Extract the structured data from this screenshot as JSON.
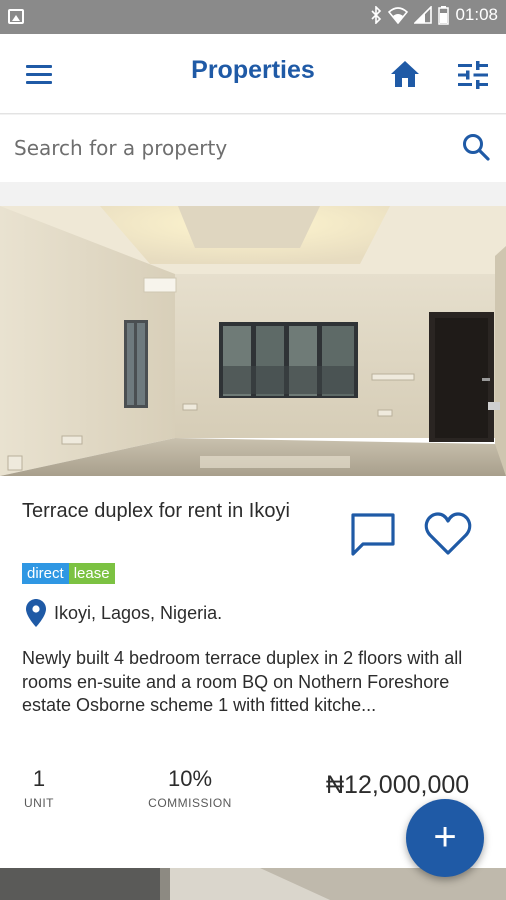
{
  "statusbar": {
    "time": "01:08"
  },
  "appbar": {
    "title": "Properties"
  },
  "search": {
    "placeholder": "Search for a property"
  },
  "listing": {
    "title": "Terrace duplex for rent in Ikoyi",
    "tags": [
      "direct",
      "lease"
    ],
    "location": "Ikoyi, Lagos, Nigeria.",
    "description": "Newly built 4 bedroom terrace duplex in 2 floors with all rooms en-suite and a room BQ on Nothern Foreshore estate Osborne scheme 1 with fitted kitche...",
    "units": {
      "value": "1",
      "label": "UNIT"
    },
    "commission": {
      "value": "10%",
      "label": "COMMISSION"
    },
    "price": "₦12,000,000"
  },
  "fab": {
    "label": "+"
  },
  "colors": {
    "primary": "#1f5aa6",
    "tag_direct": "#2f97e3",
    "tag_lease": "#7cc242",
    "statusbar": "#8a8a8a"
  },
  "icons": [
    "gallery-icon",
    "bluetooth-icon",
    "wifi-icon",
    "signal-icon",
    "battery-icon",
    "menu-icon",
    "home-icon",
    "tune-icon",
    "search-icon",
    "chat-icon",
    "heart-icon",
    "location-pin-icon",
    "add-icon"
  ]
}
